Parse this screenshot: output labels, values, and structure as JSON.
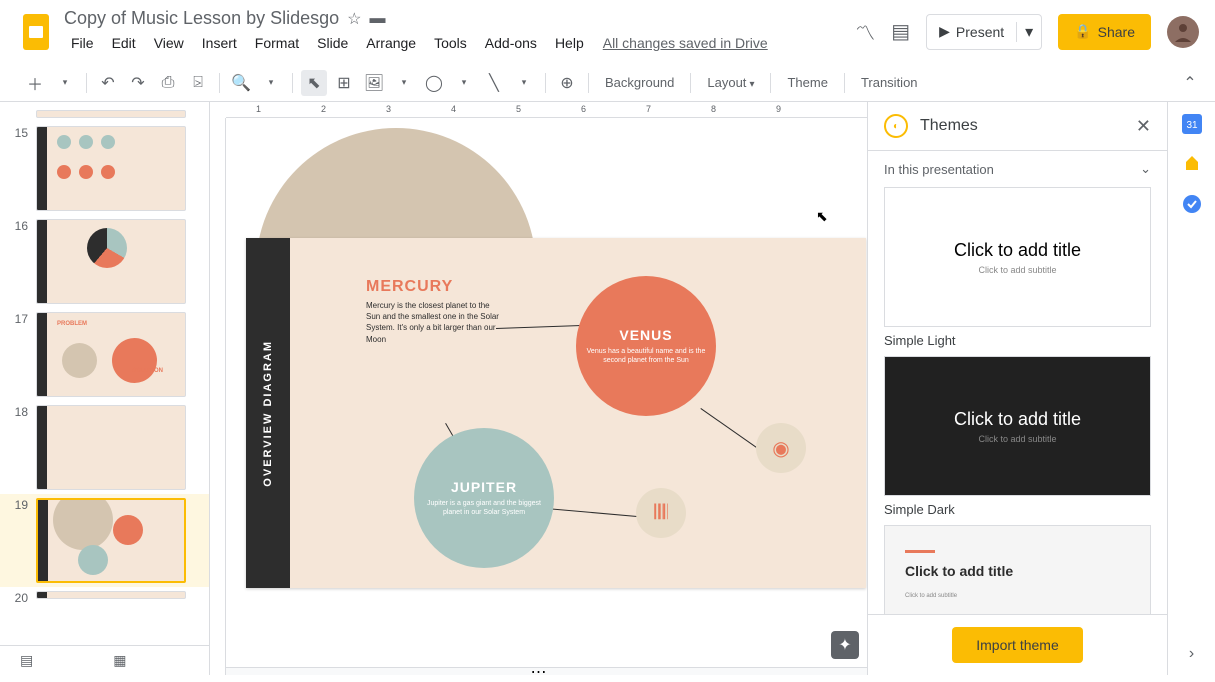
{
  "header": {
    "doc_title": "Copy of Music Lesson by Slidesgo",
    "saved": "All changes saved in Drive",
    "present": "Present",
    "share": "Share"
  },
  "menu": [
    "File",
    "Edit",
    "View",
    "Insert",
    "Format",
    "Slide",
    "Arrange",
    "Tools",
    "Add-ons",
    "Help"
  ],
  "toolbar": {
    "background": "Background",
    "layout": "Layout",
    "theme": "Theme",
    "transition": "Transition"
  },
  "filmstrip": [
    {
      "num": "15"
    },
    {
      "num": "16"
    },
    {
      "num": "17"
    },
    {
      "num": "18"
    },
    {
      "num": "19",
      "active": true
    },
    {
      "num": "20"
    }
  ],
  "ruler": [
    "1",
    "2",
    "3",
    "4",
    "5",
    "6",
    "7",
    "8",
    "9"
  ],
  "slide": {
    "side_label": "OVERVIEW DIAGRAM",
    "mercury": {
      "title": "MERCURY",
      "text": "Mercury is the closest planet to the Sun and the smallest one in the Solar System. It's only a bit larger than our Moon"
    },
    "venus": {
      "title": "VENUS",
      "text": "Venus has a beautiful name and is the second planet from the Sun"
    },
    "jupiter": {
      "title": "JUPITER",
      "text": "Jupiter is a gas giant and the biggest planet in our Solar System"
    }
  },
  "themes": {
    "title": "Themes",
    "subtitle": "In this presentation",
    "items": [
      {
        "preview_title": "Click to add title",
        "preview_sub": "Click to add subtitle",
        "name": "Simple Light",
        "class": "light"
      },
      {
        "preview_title": "Click to add title",
        "preview_sub": "Click to add subtitle",
        "name": "Simple Dark",
        "class": "dark"
      },
      {
        "preview_title": "Click to add title",
        "preview_sub": "Click to add subtitle",
        "name": "",
        "class": "custom"
      }
    ],
    "import": "Import theme"
  }
}
